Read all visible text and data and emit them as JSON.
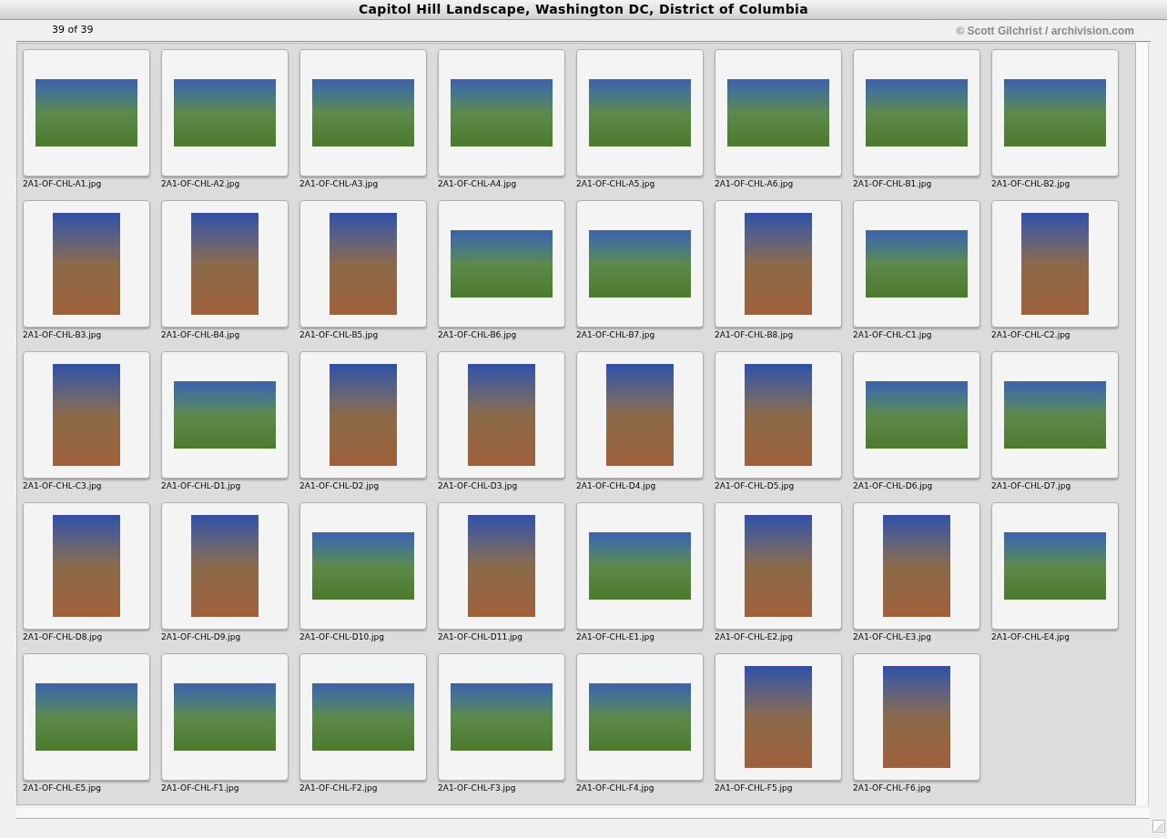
{
  "window": {
    "title": "Capitol Hill Landscape, Washington DC, District of Columbia"
  },
  "counter": "39 of 39",
  "credit": "© Scott Gilchrist / archivision.com",
  "thumbnails": [
    {
      "label": "2A1-OF-CHL-A1.jpg",
      "kind": "landscape"
    },
    {
      "label": "2A1-OF-CHL-A2.jpg",
      "kind": "landscape"
    },
    {
      "label": "2A1-OF-CHL-A3.jpg",
      "kind": "landscape"
    },
    {
      "label": "2A1-OF-CHL-A4.jpg",
      "kind": "landscape"
    },
    {
      "label": "2A1-OF-CHL-A5.jpg",
      "kind": "landscape"
    },
    {
      "label": "2A1-OF-CHL-A6.jpg",
      "kind": "landscape"
    },
    {
      "label": "2A1-OF-CHL-B1.jpg",
      "kind": "landscape"
    },
    {
      "label": "2A1-OF-CHL-B2.jpg",
      "kind": "landscape"
    },
    {
      "label": "2A1-OF-CHL-B3.jpg",
      "kind": "portrait"
    },
    {
      "label": "2A1-OF-CHL-B4.jpg",
      "kind": "portrait"
    },
    {
      "label": "2A1-OF-CHL-B5.jpg",
      "kind": "portrait"
    },
    {
      "label": "2A1-OF-CHL-B6.jpg",
      "kind": "landscape"
    },
    {
      "label": "2A1-OF-CHL-B7.jpg",
      "kind": "landscape"
    },
    {
      "label": "2A1-OF-CHL-B8.jpg",
      "kind": "portrait"
    },
    {
      "label": "2A1-OF-CHL-C1.jpg",
      "kind": "landscape"
    },
    {
      "label": "2A1-OF-CHL-C2.jpg",
      "kind": "portrait"
    },
    {
      "label": "2A1-OF-CHL-C3.jpg",
      "kind": "portrait"
    },
    {
      "label": "2A1-OF-CHL-D1.jpg",
      "kind": "landscape"
    },
    {
      "label": "2A1-OF-CHL-D2.jpg",
      "kind": "portrait"
    },
    {
      "label": "2A1-OF-CHL-D3.jpg",
      "kind": "portrait"
    },
    {
      "label": "2A1-OF-CHL-D4.jpg",
      "kind": "portrait"
    },
    {
      "label": "2A1-OF-CHL-D5.jpg",
      "kind": "portrait"
    },
    {
      "label": "2A1-OF-CHL-D6.jpg",
      "kind": "landscape"
    },
    {
      "label": "2A1-OF-CHL-D7.jpg",
      "kind": "landscape"
    },
    {
      "label": "2A1-OF-CHL-D8.jpg",
      "kind": "portrait"
    },
    {
      "label": "2A1-OF-CHL-D9.jpg",
      "kind": "portrait"
    },
    {
      "label": "2A1-OF-CHL-D10.jpg",
      "kind": "landscape"
    },
    {
      "label": "2A1-OF-CHL-D11.jpg",
      "kind": "portrait"
    },
    {
      "label": "2A1-OF-CHL-E1.jpg",
      "kind": "landscape"
    },
    {
      "label": "2A1-OF-CHL-E2.jpg",
      "kind": "portrait"
    },
    {
      "label": "2A1-OF-CHL-E3.jpg",
      "kind": "portrait"
    },
    {
      "label": "2A1-OF-CHL-E4.jpg",
      "kind": "landscape"
    },
    {
      "label": "2A1-OF-CHL-E5.jpg",
      "kind": "landscape"
    },
    {
      "label": "2A1-OF-CHL-F1.jpg",
      "kind": "landscape"
    },
    {
      "label": "2A1-OF-CHL-F2.jpg",
      "kind": "landscape"
    },
    {
      "label": "2A1-OF-CHL-F3.jpg",
      "kind": "landscape"
    },
    {
      "label": "2A1-OF-CHL-F4.jpg",
      "kind": "landscape"
    },
    {
      "label": "2A1-OF-CHL-F5.jpg",
      "kind": "portrait"
    },
    {
      "label": "2A1-OF-CHL-F6.jpg",
      "kind": "portrait"
    }
  ]
}
